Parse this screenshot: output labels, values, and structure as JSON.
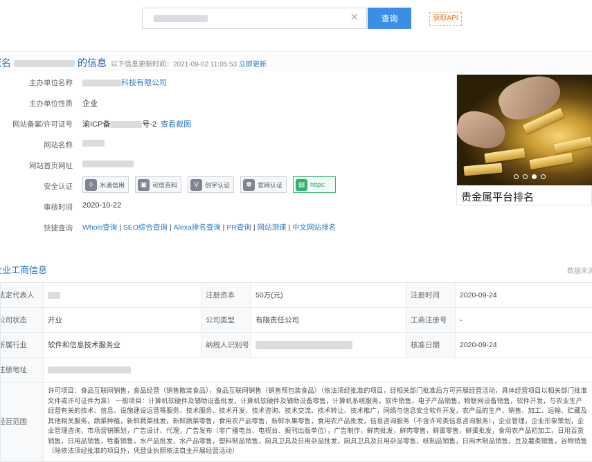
{
  "search": {
    "placeholder": "",
    "button_label": "查询",
    "api_label": "获取API"
  },
  "header": {
    "title_prefix": "域名",
    "title_suffix": "的信息",
    "update_prefix": "以下信息更新时间：",
    "update_time": "2021-09-02 11:05:53",
    "update_link": "立即更新"
  },
  "info": {
    "rows": [
      {
        "label": "主办单位名称",
        "value": "科技有限公司"
      },
      {
        "label": "主办单位性质",
        "value": "企业"
      },
      {
        "label": "网站备案/许可证号",
        "value": "渝ICP备",
        "value_tail": "号-2",
        "link": "查看截图"
      },
      {
        "label": "网站名称",
        "value": ""
      },
      {
        "label": "网站首页网址",
        "value": ""
      },
      {
        "label": "安全认证",
        "value": ""
      },
      {
        "label": "审核时间",
        "value": "2020-10-22"
      },
      {
        "label": "快捷查询",
        "value": ""
      }
    ],
    "badges": [
      {
        "icon": "water-drop-icon",
        "glyph": "◊",
        "label": "水滴信用"
      },
      {
        "icon": "monitor-icon",
        "glyph": "▣",
        "label": "可信百科"
      },
      {
        "icon": "v-badge-icon",
        "glyph": "V",
        "label": "创宇认证"
      },
      {
        "icon": "paw-icon",
        "glyph": "✽",
        "label": "官网认证"
      },
      {
        "icon": "lock-icon",
        "glyph": "▤",
        "label": "https:"
      }
    ],
    "quick_links": [
      "Whois查询",
      "SEO综合查询",
      "Alexa排名查询",
      "PR查询",
      "网站测速",
      "中文网站排名"
    ]
  },
  "ad": {
    "caption": "贵金属平台排名",
    "slide_index": 3,
    "slide_count": 4
  },
  "business": {
    "title": "企业工商信息",
    "source_label": "数据来源",
    "rows": [
      [
        {
          "k": "法定代表人",
          "v": ""
        },
        {
          "k": "注册资本",
          "v": "50万(元)"
        },
        {
          "k": "注册时间",
          "v": "2020-09-24"
        }
      ],
      [
        {
          "k": "公司状态",
          "v": "开业"
        },
        {
          "k": "公司类型",
          "v": "有限责任公司"
        },
        {
          "k": "工商注册号",
          "v": "-"
        }
      ],
      [
        {
          "k": "所属行业",
          "v": "软件和信息技术服务业"
        },
        {
          "k": "纳税人识别号",
          "v": ""
        },
        {
          "k": "核准日期",
          "v": "2020-09-24"
        }
      ]
    ],
    "address_label": "注册地址",
    "scope_label": "经营范围",
    "scope_text": "许可项目：食品互联网销售，食品经营（销售散装食品），食品互联网销售（销售预包装食品）（依法须经批准的项目，经相关部门批准后方可开展经营活动，具体经营项目以相关部门批准文件或许可证件为准） 一般项目：计算机软硬件及辅助设备批发，计算机软硬件及辅助设备零售，计算机系统服务，软件销售，电子产品销售，物联网设备销售，软件开发，与农业生产经营有关的技术、信息、设施建设运营等服务，技术服务、技术开发、技术咨询、技术交流、技术转让、技术推广，网络与信息安全软件开发，农产品的生产、销售、加工、运输、贮藏及其他相关服务，蔬菜种植，新鲜蔬菜批发，新鲜蔬菜零售，食用农产品零售，新鲜水果零售，食用农产品批发，信息咨询服务（不含许可类信息咨询服务），企业管理，企业形象策划，企业管理咨询，市场营销策划，广告设计、代理，广告发布（非广播电台、电视台、报刊出版单位），广告制作，鲜肉批发，鲜肉零售，鲜蛋零售，鲜蛋批发，食用农产品初加工，日用百货销售，日用品销售，牲畜销售，水产品批发，水产品零售，塑料制品销售，厨具卫具及日用杂品批发，厨具卫具及日用杂品零售，纸制品销售，日用木制品销售，豆及薯类销售，谷物销售（除依法须经批准的项目外，凭营业执照依法自主开展经营活动）"
  }
}
